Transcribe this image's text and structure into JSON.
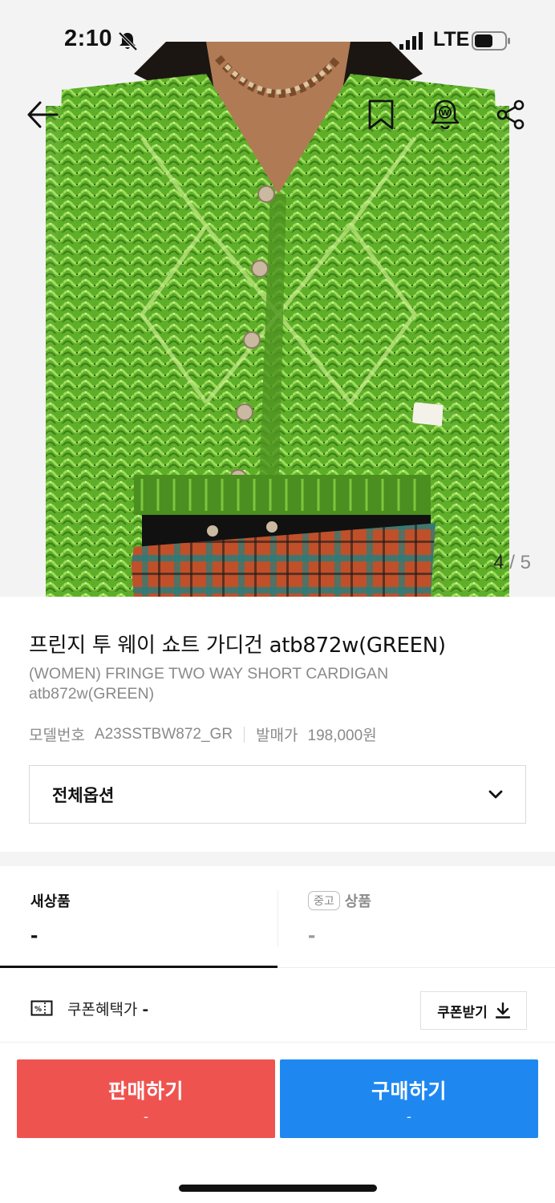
{
  "status_bar": {
    "time": "2:10",
    "network": "LTE"
  },
  "nav": {
    "back_icon": "arrow-left-icon",
    "bookmark_icon": "bookmark-icon",
    "alert_icon": "bell-icon",
    "share_icon": "share-icon"
  },
  "gallery": {
    "current": "4",
    "separator": " / ",
    "total": "5"
  },
  "product": {
    "title_ko": "프린지 투 웨이 쇼트 가디건 atb872w(GREEN)",
    "title_en": "(WOMEN) FRINGE TWO WAY SHORT CARDIGAN atb872w(GREEN)",
    "model_label": "모델번호",
    "model_value": "A23SSTBW872_GR",
    "release_label": "발매가",
    "release_value": "198,000원"
  },
  "option_select": {
    "label": "전체옵션"
  },
  "tabs": {
    "new_label": "새상품",
    "new_value": "-",
    "used_badge": "중고",
    "used_label": "상품",
    "used_value": "-"
  },
  "coupon": {
    "label": "쿠폰혜택가",
    "value": "-",
    "button_label": "쿠폰받기"
  },
  "actions": {
    "sell_label": "판매하기",
    "sell_sub": "-",
    "buy_label": "구매하기",
    "buy_sub": "-"
  },
  "colors": {
    "sell": "#ef5350",
    "buy": "#1e88f0",
    "cardigan_green": "#6fbf2f"
  }
}
